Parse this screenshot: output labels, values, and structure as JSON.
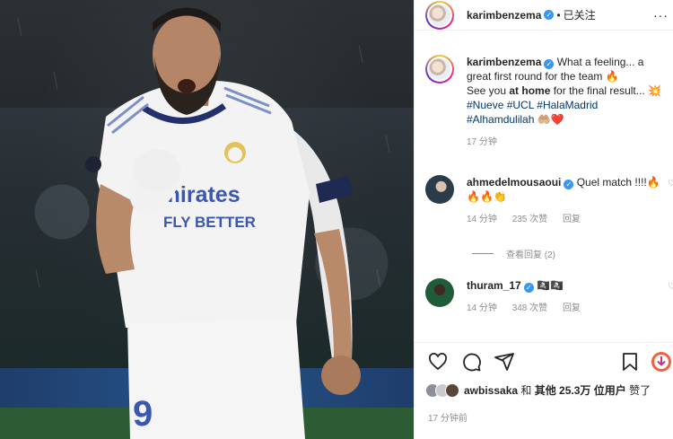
{
  "post": {
    "username": "karimbenzema",
    "follow_label": "已关注",
    "more_icon": "more-icon"
  },
  "caption": {
    "username": "karimbenzema",
    "line1": "What a feeling... a great first round for the team 🔥",
    "line2_a": "See you ",
    "line2_bold": "at home",
    "line2_b": " for the final result... 💥",
    "hashtags": "#Nueve #UCL #HalaMadrid",
    "line4": "#Alhamdulilah 🤲🏼❤️",
    "time": "17 分钟"
  },
  "comments": [
    {
      "username": "ahmedelmousaoui",
      "text": "Quel match !!!!🔥🔥🔥👏",
      "time": "14 分钟",
      "likes": "235 次赞",
      "reply": "回复"
    },
    {
      "username": "thuram_17",
      "text": "🏴‍☠️🏴‍☠️",
      "time": "14 分钟",
      "likes": "348 次赞",
      "reply": "回复"
    }
  ],
  "view_replies": "查看回复 (2)",
  "likes_line": {
    "user": "awbissaka",
    "middle": " 和 ",
    "others": "其他 25.3万 位用户",
    "suffix": " 赞了"
  },
  "time_ago": "17 分钟前",
  "colors": {
    "link": "#00376b",
    "verified": "#3897f0",
    "heart": "#ed4956",
    "secondary": "#8e8e8e"
  }
}
